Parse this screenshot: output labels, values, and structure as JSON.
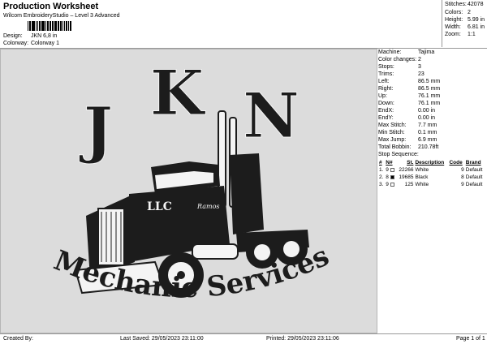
{
  "header": {
    "title": "Production Worksheet",
    "subtitle": "Wilcom EmbroideryStudio – Level 3 Advanced",
    "design_label": "Design:",
    "design_value": "JKN 6,8 in",
    "colorway_label": "Colorway:",
    "colorway_value": "Colorway 1"
  },
  "summary": [
    {
      "label": "Stitches:",
      "value": "42078"
    },
    {
      "label": "Colors:",
      "value": "2"
    },
    {
      "label": "Height:",
      "value": "5.99 in"
    },
    {
      "label": "Width:",
      "value": "6.81 in"
    },
    {
      "label": "Zoom:",
      "value": "1:1"
    }
  ],
  "design_text": {
    "initials": [
      "J",
      "K",
      "N"
    ],
    "llc": "LLC",
    "script": "Ramos",
    "slogan": "Mechanic Services"
  },
  "details": [
    {
      "label": "Machine:",
      "value": "Tajima"
    },
    {
      "label": "Color changes:",
      "value": "2"
    },
    {
      "label": "Stops:",
      "value": "3"
    },
    {
      "label": "Trims:",
      "value": "23"
    },
    {
      "label": "Left:",
      "value": "86.5 mm"
    },
    {
      "label": "Right:",
      "value": "86.5 mm"
    },
    {
      "label": "Up:",
      "value": "76.1 mm"
    },
    {
      "label": "Down:",
      "value": "76.1 mm"
    },
    {
      "label": "EndX:",
      "value": "0.00 in"
    },
    {
      "label": "EndY:",
      "value": "0.00 in"
    },
    {
      "label": "Max Stitch:",
      "value": "7.7 mm"
    },
    {
      "label": "Min Stitch:",
      "value": "0.1 mm"
    },
    {
      "label": "Max Jump:",
      "value": "6.9 mm"
    },
    {
      "label": "Total Bobbin:",
      "value": "210.78ft"
    }
  ],
  "stop_sequence": {
    "title": "Stop Sequence:",
    "columns": [
      "#",
      "N#",
      "St.",
      "Description",
      "Code",
      "Brand"
    ],
    "rows": [
      {
        "num": "1.",
        "needle": "9",
        "stitches": "22266",
        "swatch": "#ffffff",
        "description": "White",
        "code": "9",
        "brand": "Default"
      },
      {
        "num": "2.",
        "needle": "8",
        "stitches": "19685",
        "swatch": "#000000",
        "description": "Black",
        "code": "8",
        "brand": "Default"
      },
      {
        "num": "3.",
        "needle": "9",
        "stitches": "125",
        "swatch": "#ffffff",
        "description": "White",
        "code": "9",
        "brand": "Default"
      }
    ]
  },
  "footer": {
    "created": "Created By:",
    "last_saved": "Last Saved: 29/05/2023 23:11:00",
    "printed": "Printed: 29/05/2023 23:11:06",
    "page": "Page 1 of 1"
  },
  "colors": {
    "canvas": "#dcdcdc",
    "thread_black": "#1c1c1c",
    "thread_white": "#f4f4f4"
  }
}
